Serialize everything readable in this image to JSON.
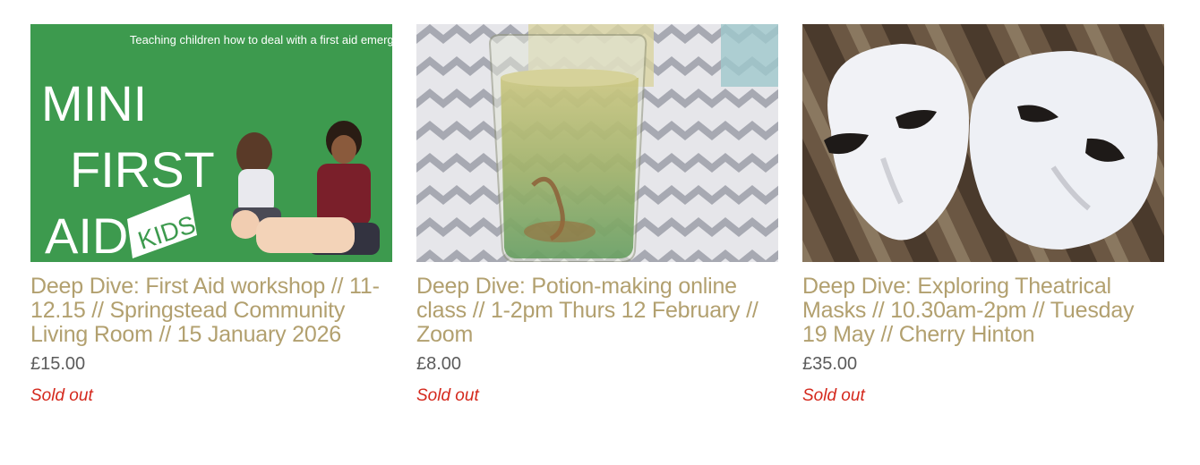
{
  "products": [
    {
      "image_text_top": "Teaching children how to deal with a first aid emergency",
      "image_text_main": "MINI FIRST AID",
      "image_text_badge": "KIDS",
      "title": "Deep Dive: First Aid workshop // 11-12.15 // Springstead Community Living Room // 15 January 2026",
      "price": "£15.00",
      "status": "Sold out"
    },
    {
      "title": "Deep Dive: Potion-making online class // 1-2pm Thurs 12 February // Zoom",
      "price": "£8.00",
      "status": "Sold out"
    },
    {
      "title": "Deep Dive: Exploring Theatrical Masks // 10.30am-2pm // Tuesday 19 May // Cherry Hinton",
      "price": "£35.00",
      "status": "Sold out"
    }
  ],
  "colors": {
    "title": "#b2a06f",
    "price": "#5b5b5b",
    "sold": "#d4281c",
    "first_aid_green": "#3d9a4e"
  }
}
